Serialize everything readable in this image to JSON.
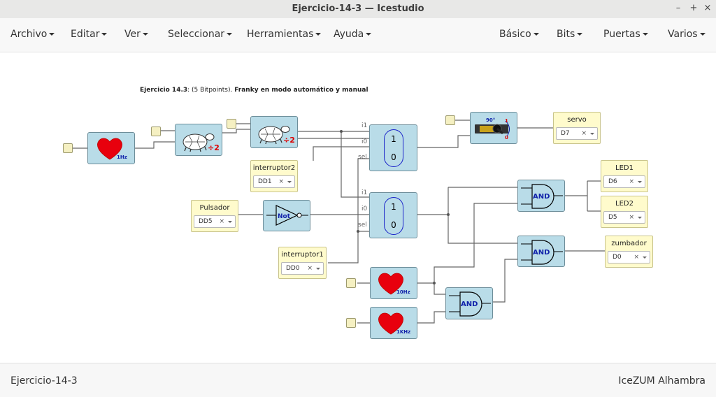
{
  "window": {
    "title": "Ejercicio-14-3 — Icestudio"
  },
  "menu_left": [
    "Archivo",
    "Editar",
    "Ver",
    "Seleccionar",
    "Herramientas",
    "Ayuda"
  ],
  "menu_right": [
    "Básico",
    "Bits",
    "Puertas",
    "Varios"
  ],
  "description": {
    "prefix": "Ejercicio 14.3",
    "middle": ": (5 Bitpoints). ",
    "bold": "Franky en modo automático y manual"
  },
  "blocks": {
    "heart_1": {
      "label": "1Hz"
    },
    "heart_2": {
      "label": "10Hz"
    },
    "heart_3": {
      "label": "1KHz"
    },
    "div_1": {
      "label": "÷2"
    },
    "div_2": {
      "label": "÷2"
    },
    "not": {
      "label": "Not"
    },
    "and_1": {
      "label": "AND"
    },
    "and_2": {
      "label": "AND"
    },
    "and_3": {
      "label": "AND"
    },
    "servo_img": {
      "deg": "90°",
      "one": "1",
      "zero": "0"
    }
  },
  "mux": [
    {
      "i1": "i1",
      "i0": "i0",
      "sel": "sel",
      "top": "1",
      "bottom": "0"
    },
    {
      "i1": "i1",
      "i0": "i0",
      "sel": "sel",
      "top": "1",
      "bottom": "0"
    }
  ],
  "io": {
    "interruptor2": {
      "name": "interruptor2",
      "pin": "DD1"
    },
    "interruptor1": {
      "name": "interruptor1",
      "pin": "DD0"
    },
    "pulsador": {
      "name": "Pulsador",
      "pin": "DD5"
    },
    "servo": {
      "name": "servo",
      "pin": "D7"
    },
    "led1": {
      "name": "LED1",
      "pin": "D6"
    },
    "led2": {
      "name": "LED2",
      "pin": "D5"
    },
    "zumbador": {
      "name": "zumbador",
      "pin": "D0"
    }
  },
  "clear_glyph": "×",
  "status": {
    "left": "Ejercicio-14-3",
    "right": "IceZUM Alhambra"
  }
}
